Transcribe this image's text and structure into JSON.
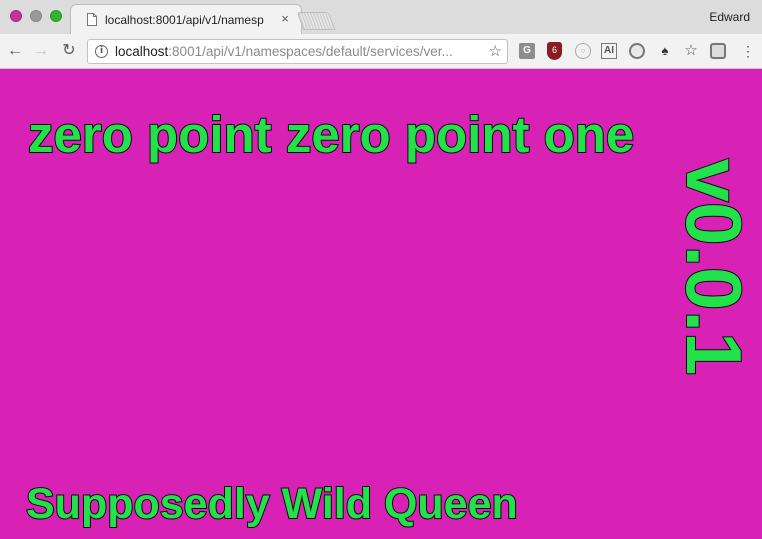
{
  "browser": {
    "tab": {
      "title": "localhost:8001/api/v1/namesp",
      "favicon": "document-icon",
      "close_label": "×"
    },
    "profile_name": "Edward",
    "toolbar": {
      "back_label": "←",
      "forward_label": "→",
      "reload_label": "↻",
      "info_label": "i",
      "url_host": "localhost",
      "url_rest": ":8001/api/v1/namespaces/default/services/ver...",
      "bookmark_label": "☆",
      "extensions": [
        {
          "name": "translate-icon",
          "glyph": "G"
        },
        {
          "name": "shield-icon",
          "glyph": "6"
        },
        {
          "name": "circle-extension-icon",
          "glyph": "○"
        },
        {
          "name": "ai-icon",
          "glyph": "AI"
        },
        {
          "name": "disc-icon",
          "glyph": ""
        },
        {
          "name": "mask-icon",
          "glyph": "♠"
        },
        {
          "name": "star-plus-icon",
          "glyph": "☆"
        },
        {
          "name": "square-extension-icon",
          "glyph": ""
        },
        {
          "name": "menu-icon",
          "glyph": "⋮"
        }
      ]
    },
    "traffic_light_colors": {
      "close": "#c4339e",
      "minimize": "#9a9a9a",
      "maximize": "#34b233"
    }
  },
  "page": {
    "background_color": "#d822b6",
    "text_color": "#22e14a",
    "heading": "zero point zero point one",
    "version": "v0.0.1",
    "footer": "Supposedly Wild Queen"
  }
}
